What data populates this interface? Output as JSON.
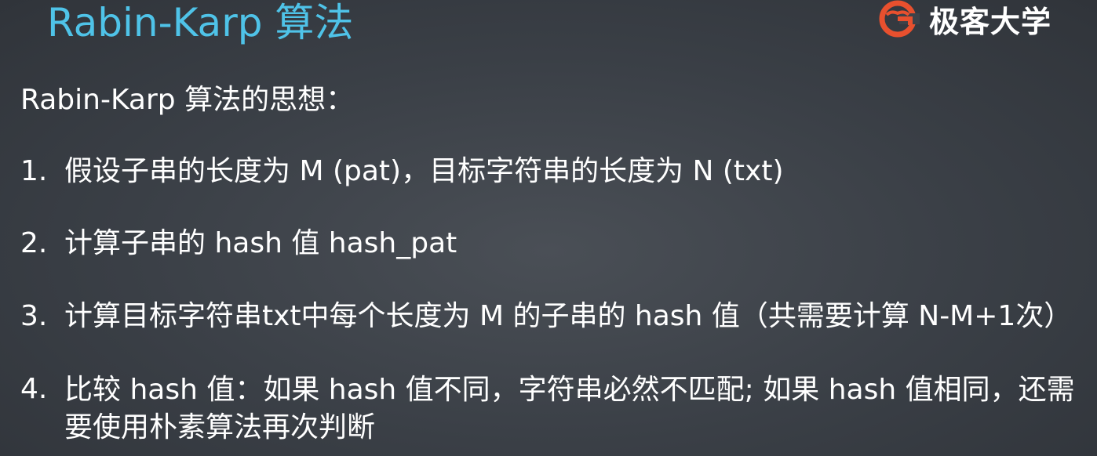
{
  "title": "Rabin-Karp 算法",
  "logo": {
    "icon": "geek-university-logo-icon",
    "text": "极客大学",
    "color": "#e8502e"
  },
  "intro": "Rabin-Karp 算法的思想：",
  "points": [
    {
      "num": "1.",
      "text": "假设子串的长度为 M (pat)，目标字符串的长度为 N (txt)"
    },
    {
      "num": "2.",
      "text": "计算子串的 hash 值 hash_pat"
    },
    {
      "num": "3.",
      "text": "计算目标字符串txt中每个长度为 M 的子串的 hash 值（共需要计算 N-M+1次）"
    },
    {
      "num": "4.",
      "text": "比较 hash 值：如果 hash 值不同，字符串必然不匹配; 如果 hash 值相同，还需要使用朴素算法再次判断"
    }
  ],
  "colors": {
    "title": "#4fc3e8",
    "text": "#ffffff",
    "background": "#3a3f46"
  }
}
